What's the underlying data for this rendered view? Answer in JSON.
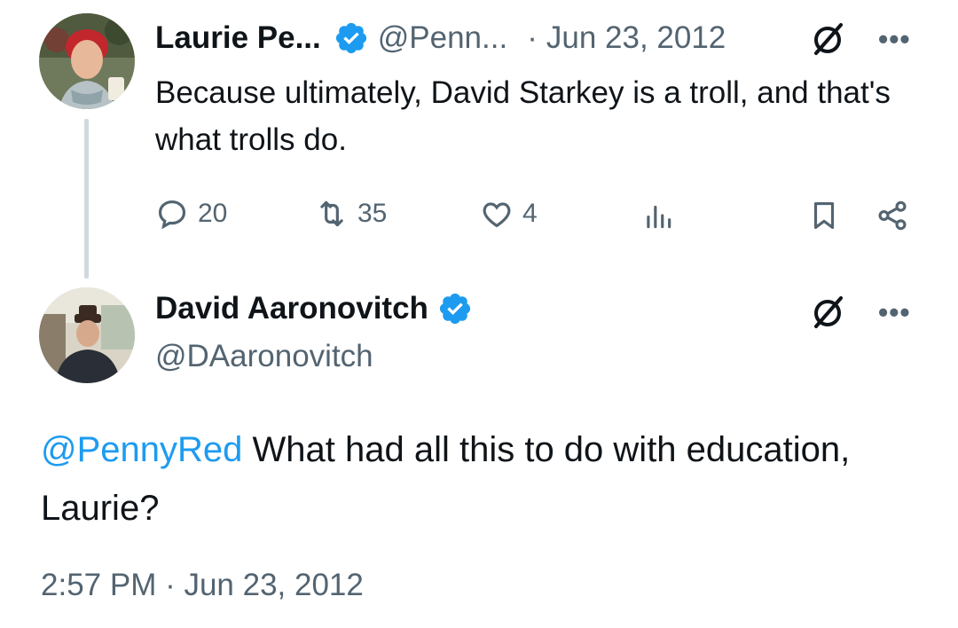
{
  "parent": {
    "name": "Laurie Pe...",
    "handle": "@Penn...",
    "dot": "·",
    "date": "Jun 23, 2012",
    "more": "•••",
    "text": "Because ultimately, David Starkey is a troll, and that's what trolls do.",
    "actions": {
      "replies": "20",
      "reposts": "35",
      "likes": "4"
    }
  },
  "reply": {
    "name": "David Aaronovitch",
    "handle": "@DAaronovitch",
    "more": "•••",
    "mention": "@PennyRed",
    "text": " What had all this to do with education, Laurie?",
    "timestamp": "2:57 PM · Jun 23, 2012"
  },
  "colors": {
    "accent": "#1d9bf0",
    "secondary_text": "#536471",
    "primary_text": "#0f1419",
    "thread_line": "#cfd9de"
  },
  "icons": [
    "verified-badge-icon",
    "grok-icon",
    "more-icon",
    "reply-icon",
    "repost-icon",
    "like-icon",
    "views-icon",
    "bookmark-icon",
    "share-icon"
  ]
}
